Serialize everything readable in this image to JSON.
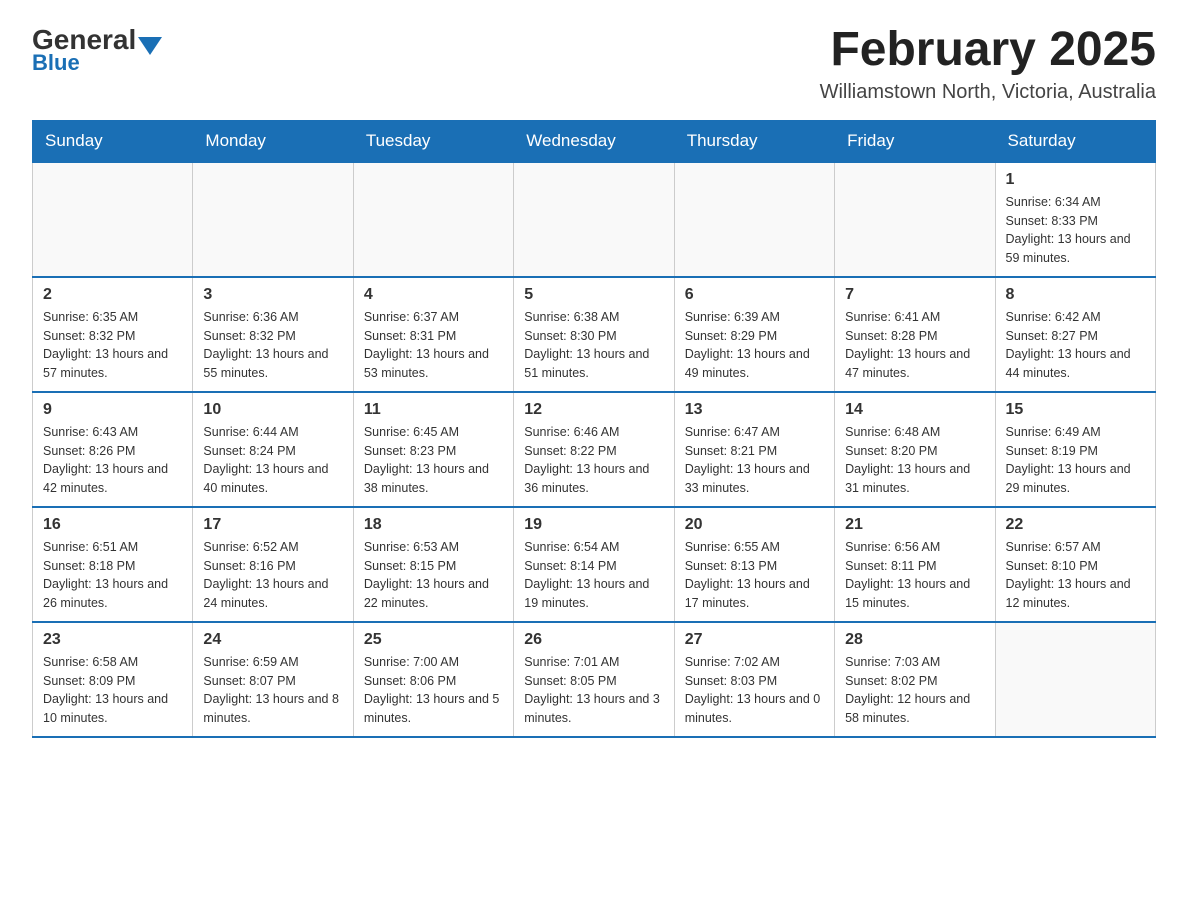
{
  "header": {
    "logo_general": "General",
    "logo_blue": "Blue",
    "main_title": "February 2025",
    "location": "Williamstown North, Victoria, Australia"
  },
  "days_of_week": [
    "Sunday",
    "Monday",
    "Tuesday",
    "Wednesday",
    "Thursday",
    "Friday",
    "Saturday"
  ],
  "weeks": [
    [
      {
        "day": "",
        "info": ""
      },
      {
        "day": "",
        "info": ""
      },
      {
        "day": "",
        "info": ""
      },
      {
        "day": "",
        "info": ""
      },
      {
        "day": "",
        "info": ""
      },
      {
        "day": "",
        "info": ""
      },
      {
        "day": "1",
        "info": "Sunrise: 6:34 AM\nSunset: 8:33 PM\nDaylight: 13 hours and 59 minutes."
      }
    ],
    [
      {
        "day": "2",
        "info": "Sunrise: 6:35 AM\nSunset: 8:32 PM\nDaylight: 13 hours and 57 minutes."
      },
      {
        "day": "3",
        "info": "Sunrise: 6:36 AM\nSunset: 8:32 PM\nDaylight: 13 hours and 55 minutes."
      },
      {
        "day": "4",
        "info": "Sunrise: 6:37 AM\nSunset: 8:31 PM\nDaylight: 13 hours and 53 minutes."
      },
      {
        "day": "5",
        "info": "Sunrise: 6:38 AM\nSunset: 8:30 PM\nDaylight: 13 hours and 51 minutes."
      },
      {
        "day": "6",
        "info": "Sunrise: 6:39 AM\nSunset: 8:29 PM\nDaylight: 13 hours and 49 minutes."
      },
      {
        "day": "7",
        "info": "Sunrise: 6:41 AM\nSunset: 8:28 PM\nDaylight: 13 hours and 47 minutes."
      },
      {
        "day": "8",
        "info": "Sunrise: 6:42 AM\nSunset: 8:27 PM\nDaylight: 13 hours and 44 minutes."
      }
    ],
    [
      {
        "day": "9",
        "info": "Sunrise: 6:43 AM\nSunset: 8:26 PM\nDaylight: 13 hours and 42 minutes."
      },
      {
        "day": "10",
        "info": "Sunrise: 6:44 AM\nSunset: 8:24 PM\nDaylight: 13 hours and 40 minutes."
      },
      {
        "day": "11",
        "info": "Sunrise: 6:45 AM\nSunset: 8:23 PM\nDaylight: 13 hours and 38 minutes."
      },
      {
        "day": "12",
        "info": "Sunrise: 6:46 AM\nSunset: 8:22 PM\nDaylight: 13 hours and 36 minutes."
      },
      {
        "day": "13",
        "info": "Sunrise: 6:47 AM\nSunset: 8:21 PM\nDaylight: 13 hours and 33 minutes."
      },
      {
        "day": "14",
        "info": "Sunrise: 6:48 AM\nSunset: 8:20 PM\nDaylight: 13 hours and 31 minutes."
      },
      {
        "day": "15",
        "info": "Sunrise: 6:49 AM\nSunset: 8:19 PM\nDaylight: 13 hours and 29 minutes."
      }
    ],
    [
      {
        "day": "16",
        "info": "Sunrise: 6:51 AM\nSunset: 8:18 PM\nDaylight: 13 hours and 26 minutes."
      },
      {
        "day": "17",
        "info": "Sunrise: 6:52 AM\nSunset: 8:16 PM\nDaylight: 13 hours and 24 minutes."
      },
      {
        "day": "18",
        "info": "Sunrise: 6:53 AM\nSunset: 8:15 PM\nDaylight: 13 hours and 22 minutes."
      },
      {
        "day": "19",
        "info": "Sunrise: 6:54 AM\nSunset: 8:14 PM\nDaylight: 13 hours and 19 minutes."
      },
      {
        "day": "20",
        "info": "Sunrise: 6:55 AM\nSunset: 8:13 PM\nDaylight: 13 hours and 17 minutes."
      },
      {
        "day": "21",
        "info": "Sunrise: 6:56 AM\nSunset: 8:11 PM\nDaylight: 13 hours and 15 minutes."
      },
      {
        "day": "22",
        "info": "Sunrise: 6:57 AM\nSunset: 8:10 PM\nDaylight: 13 hours and 12 minutes."
      }
    ],
    [
      {
        "day": "23",
        "info": "Sunrise: 6:58 AM\nSunset: 8:09 PM\nDaylight: 13 hours and 10 minutes."
      },
      {
        "day": "24",
        "info": "Sunrise: 6:59 AM\nSunset: 8:07 PM\nDaylight: 13 hours and 8 minutes."
      },
      {
        "day": "25",
        "info": "Sunrise: 7:00 AM\nSunset: 8:06 PM\nDaylight: 13 hours and 5 minutes."
      },
      {
        "day": "26",
        "info": "Sunrise: 7:01 AM\nSunset: 8:05 PM\nDaylight: 13 hours and 3 minutes."
      },
      {
        "day": "27",
        "info": "Sunrise: 7:02 AM\nSunset: 8:03 PM\nDaylight: 13 hours and 0 minutes."
      },
      {
        "day": "28",
        "info": "Sunrise: 7:03 AM\nSunset: 8:02 PM\nDaylight: 12 hours and 58 minutes."
      },
      {
        "day": "",
        "info": ""
      }
    ]
  ]
}
